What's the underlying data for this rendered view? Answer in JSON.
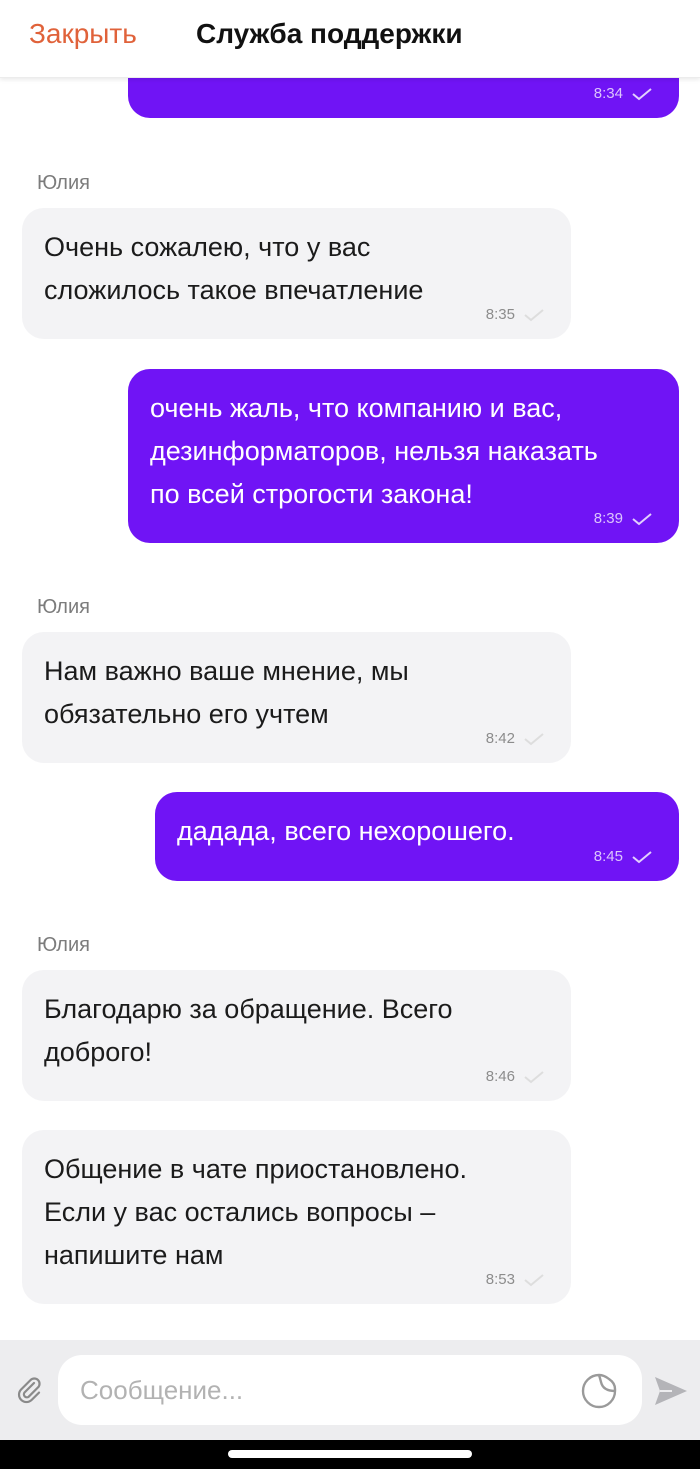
{
  "header": {
    "close_label": "Закрыть",
    "title": "Служба поддержки"
  },
  "colors": {
    "accent": "#7014f5",
    "close": "#e0623a",
    "incoming_bg": "#f3f3f5",
    "input_bar_bg": "#ededef"
  },
  "messages": [
    {
      "direction": "outgoing",
      "text": "",
      "time": "8:34",
      "status": "sent"
    },
    {
      "direction": "incoming",
      "sender": "Юлия",
      "text": "Очень сожалею, что у вас\nсложилось такое впечатление",
      "time": "8:35",
      "status": "read"
    },
    {
      "direction": "outgoing",
      "text": "очень жаль, что компанию и вас,\nдезинформаторов, нельзя наказать\nпо всей строгости закона!",
      "time": "8:39",
      "status": "sent"
    },
    {
      "direction": "incoming",
      "sender": "Юлия",
      "text": "Нам важно ваше мнение, мы\nобязательно его учтем",
      "time": "8:42",
      "status": "read"
    },
    {
      "direction": "outgoing",
      "text": "дадада, всего нехорошего.",
      "time": "8:45",
      "status": "sent"
    },
    {
      "direction": "incoming",
      "sender": "Юлия",
      "text": "Благодарю за обращение. Всего\nдоброго!",
      "time": "8:46",
      "status": "read"
    },
    {
      "direction": "incoming",
      "text": "Общение в чате приостановлено.\nЕсли у вас остались вопросы –\nнапишите нам",
      "time": "8:53",
      "status": "read"
    }
  ],
  "composer": {
    "placeholder": "Сообщение...",
    "value": "",
    "icons": [
      "paperclip-icon",
      "sticker-icon",
      "send-icon"
    ]
  }
}
